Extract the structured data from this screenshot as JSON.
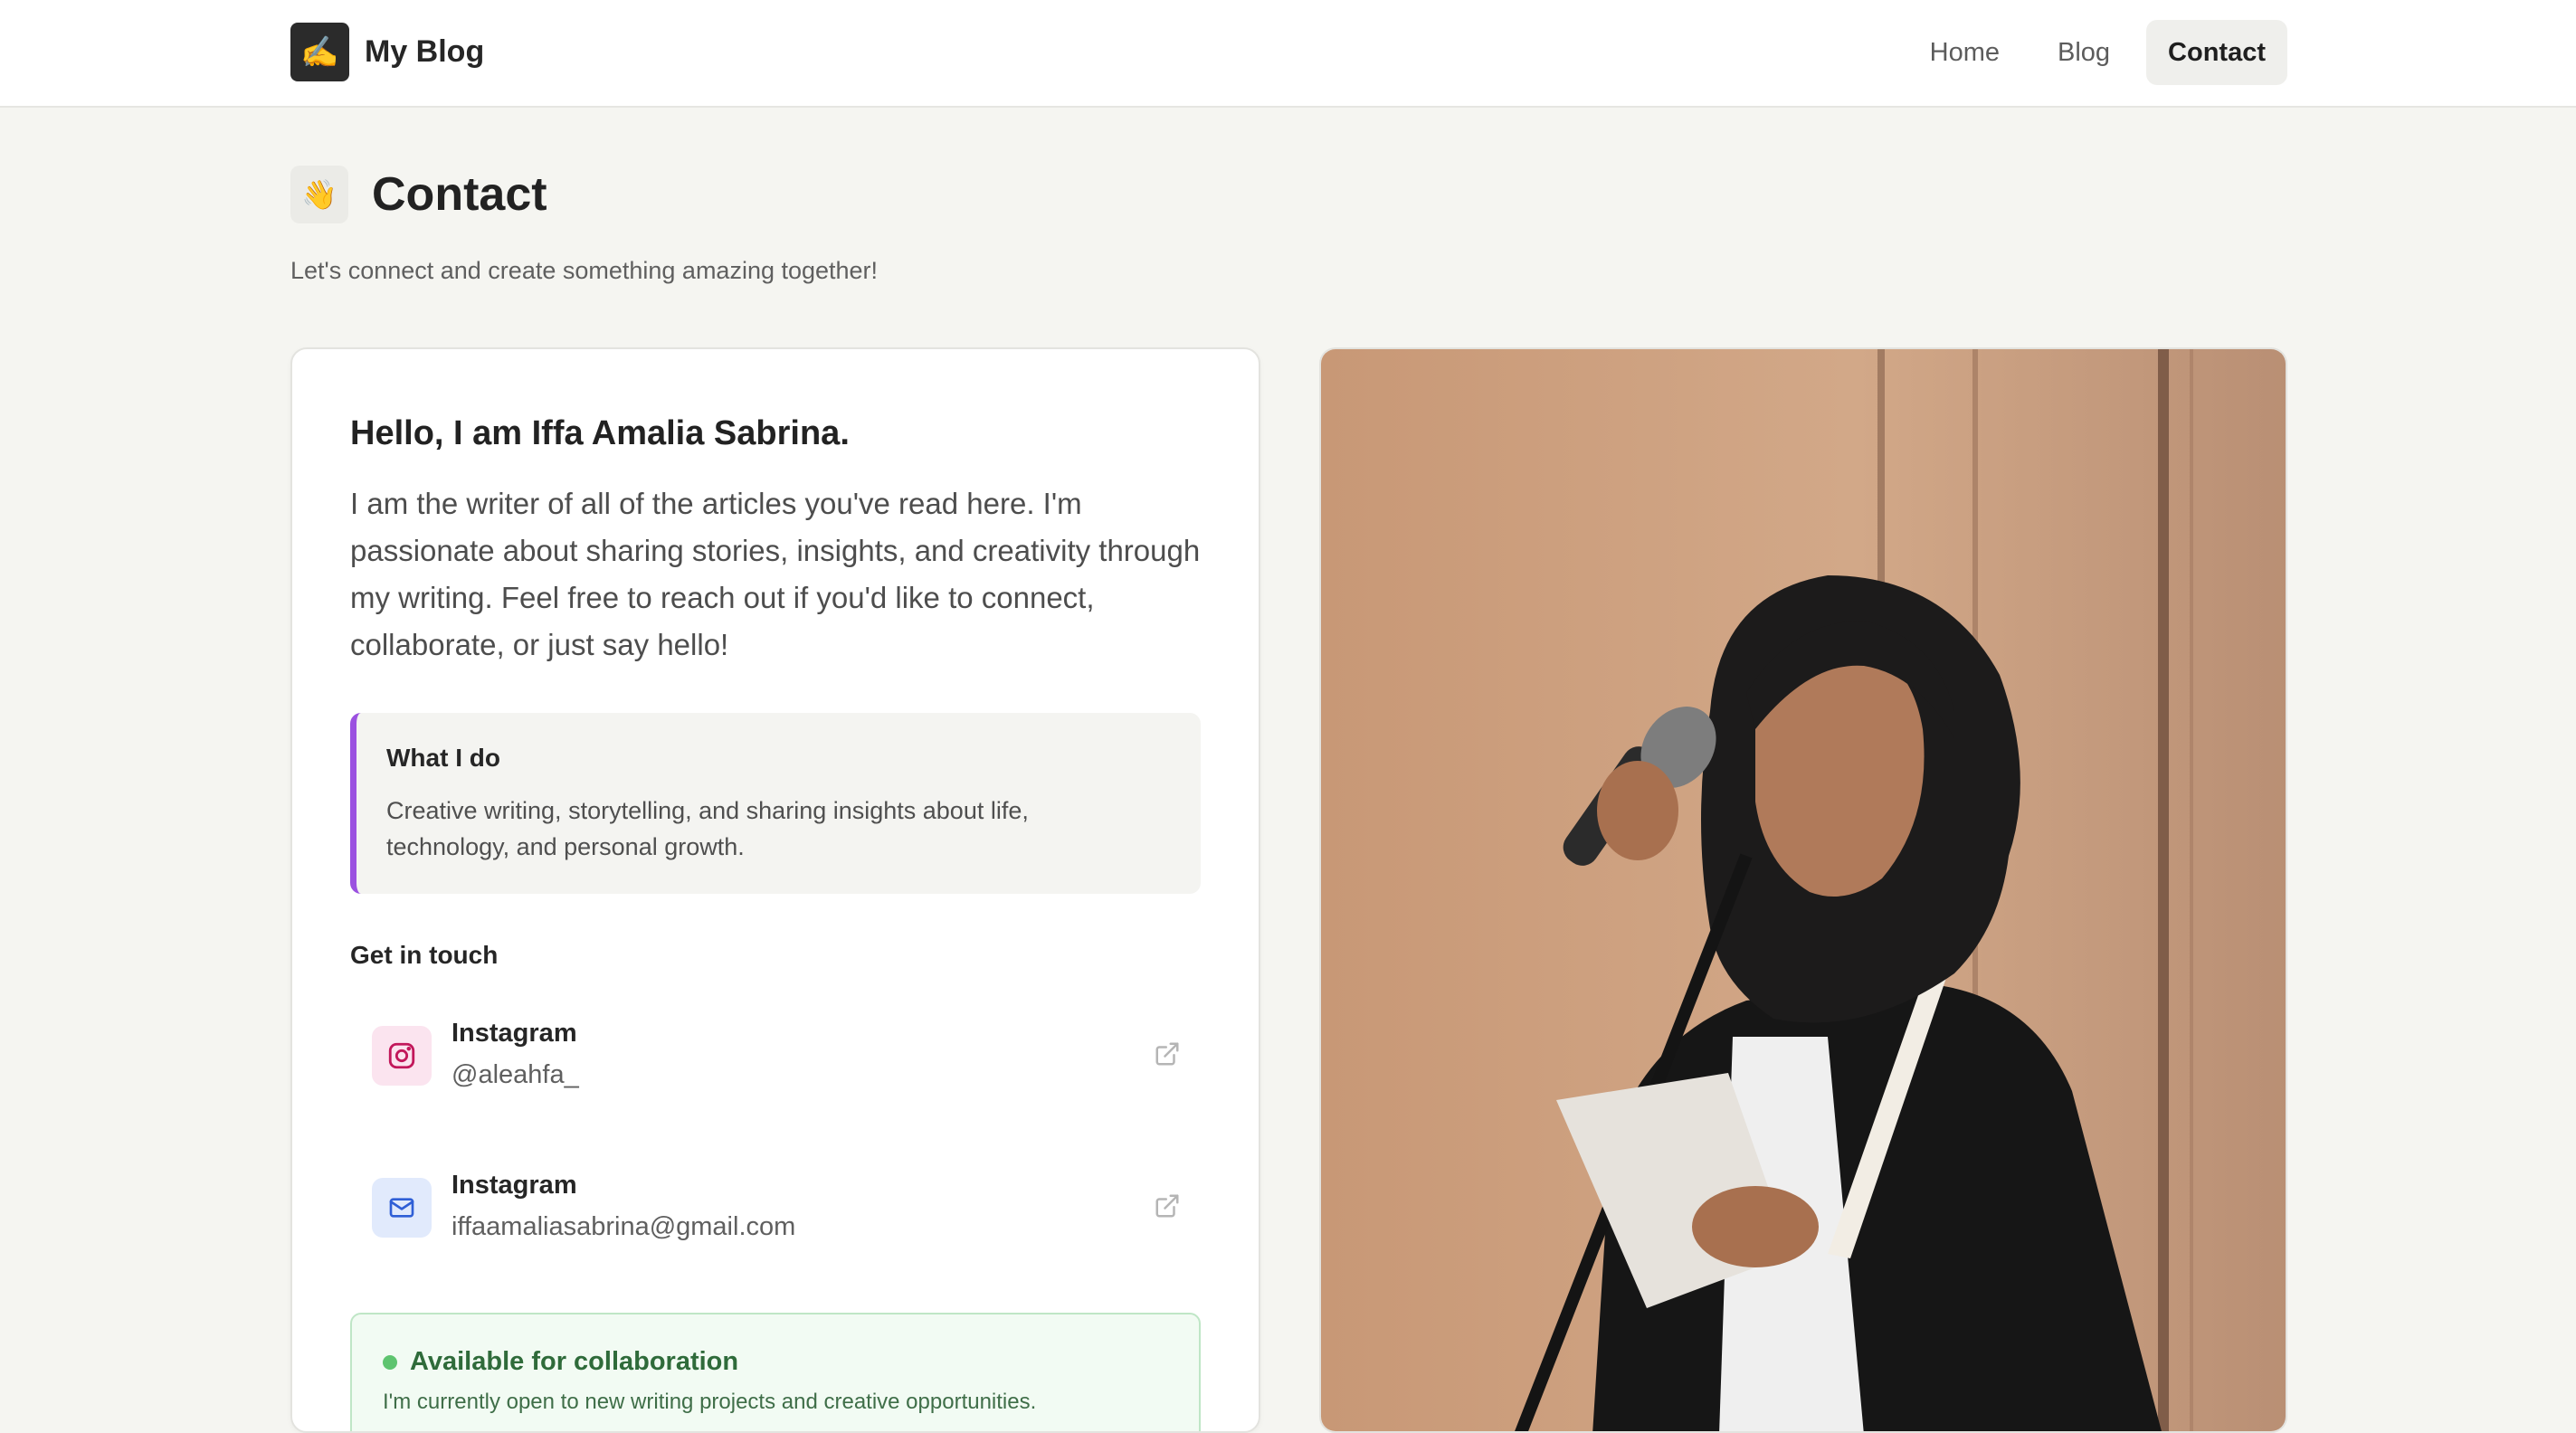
{
  "header": {
    "logo_emoji": "✍️",
    "brand": "My Blog",
    "nav": [
      {
        "label": "Home"
      },
      {
        "label": "Blog"
      },
      {
        "label": "Contact",
        "active": true
      }
    ]
  },
  "page": {
    "emoji": "👋",
    "title": "Contact",
    "subtitle": "Let's connect and create something amazing together!"
  },
  "card": {
    "greeting": "Hello, I am Iffa Amalia Sabrina.",
    "intro": "I am the writer of all of the articles you've read here. I'm passionate about sharing stories, insights, and creativity through my writing. Feel free to reach out if you'd like to connect, collaborate, or just say hello!",
    "what_i_do": {
      "title": "What I do",
      "text": "Creative writing, storytelling, and sharing insights about life, technology, and personal growth."
    },
    "get_in_touch_label": "Get in touch",
    "contacts": [
      {
        "name": "Instagram",
        "handle": "@aleahfa_",
        "icon": "instagram-icon",
        "color": "#c2185b"
      },
      {
        "name": "Instagram",
        "handle": "iffaamaliasabrina@gmail.com",
        "icon": "mail-icon",
        "color": "#2f5fd6"
      }
    ],
    "collab": {
      "title": "Available for collaboration",
      "text": "I'm currently open to new writing projects and creative opportunities."
    }
  },
  "photo": {
    "subject": "woman in black hijab reading from paper at a microphone"
  },
  "colors": {
    "accent_purple": "#9b51e0",
    "available_green": "#5ec46f",
    "page_bg": "#f5f5f1"
  }
}
